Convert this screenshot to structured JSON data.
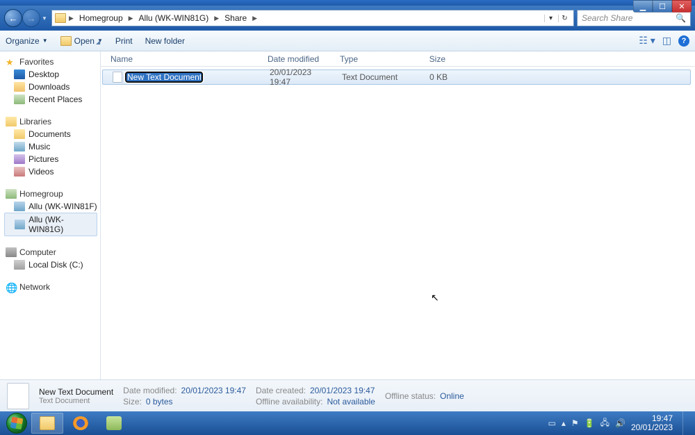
{
  "title_controls": {
    "min": "▁",
    "max": "☐",
    "close": "✕"
  },
  "breadcrumb": [
    "Homegroup",
    "Allu (WK-WIN81G)",
    "Share"
  ],
  "search_placeholder": "Search Share",
  "toolbar": {
    "organize": "Organize",
    "open": "Open",
    "print": "Print",
    "new_folder": "New folder"
  },
  "sidebar": {
    "favorites": {
      "label": "Favorites",
      "items": [
        "Desktop",
        "Downloads",
        "Recent Places"
      ]
    },
    "libraries": {
      "label": "Libraries",
      "items": [
        "Documents",
        "Music",
        "Pictures",
        "Videos"
      ]
    },
    "homegroup": {
      "label": "Homegroup",
      "items": [
        "Allu (WK-WIN81F)",
        "Allu (WK-WIN81G)"
      ]
    },
    "computer": {
      "label": "Computer",
      "items": [
        "Local Disk (C:)"
      ]
    },
    "network": {
      "label": "Network"
    }
  },
  "columns": {
    "name": "Name",
    "date": "Date modified",
    "type": "Type",
    "size": "Size"
  },
  "file": {
    "name": "New Text Document",
    "date": "20/01/2023 19:47",
    "type": "Text Document",
    "size": "0 KB"
  },
  "details": {
    "title": "New Text Document",
    "sub": "Text Document",
    "date_modified_k": "Date modified:",
    "date_modified_v": "20/01/2023 19:47",
    "size_k": "Size:",
    "size_v": "0 bytes",
    "date_created_k": "Date created:",
    "date_created_v": "20/01/2023 19:47",
    "offline_avail_k": "Offline availability:",
    "offline_avail_v": "Not available",
    "offline_status_k": "Offline status:",
    "offline_status_v": "Online"
  },
  "tray": {
    "time": "19:47",
    "date": "20/01/2023"
  }
}
